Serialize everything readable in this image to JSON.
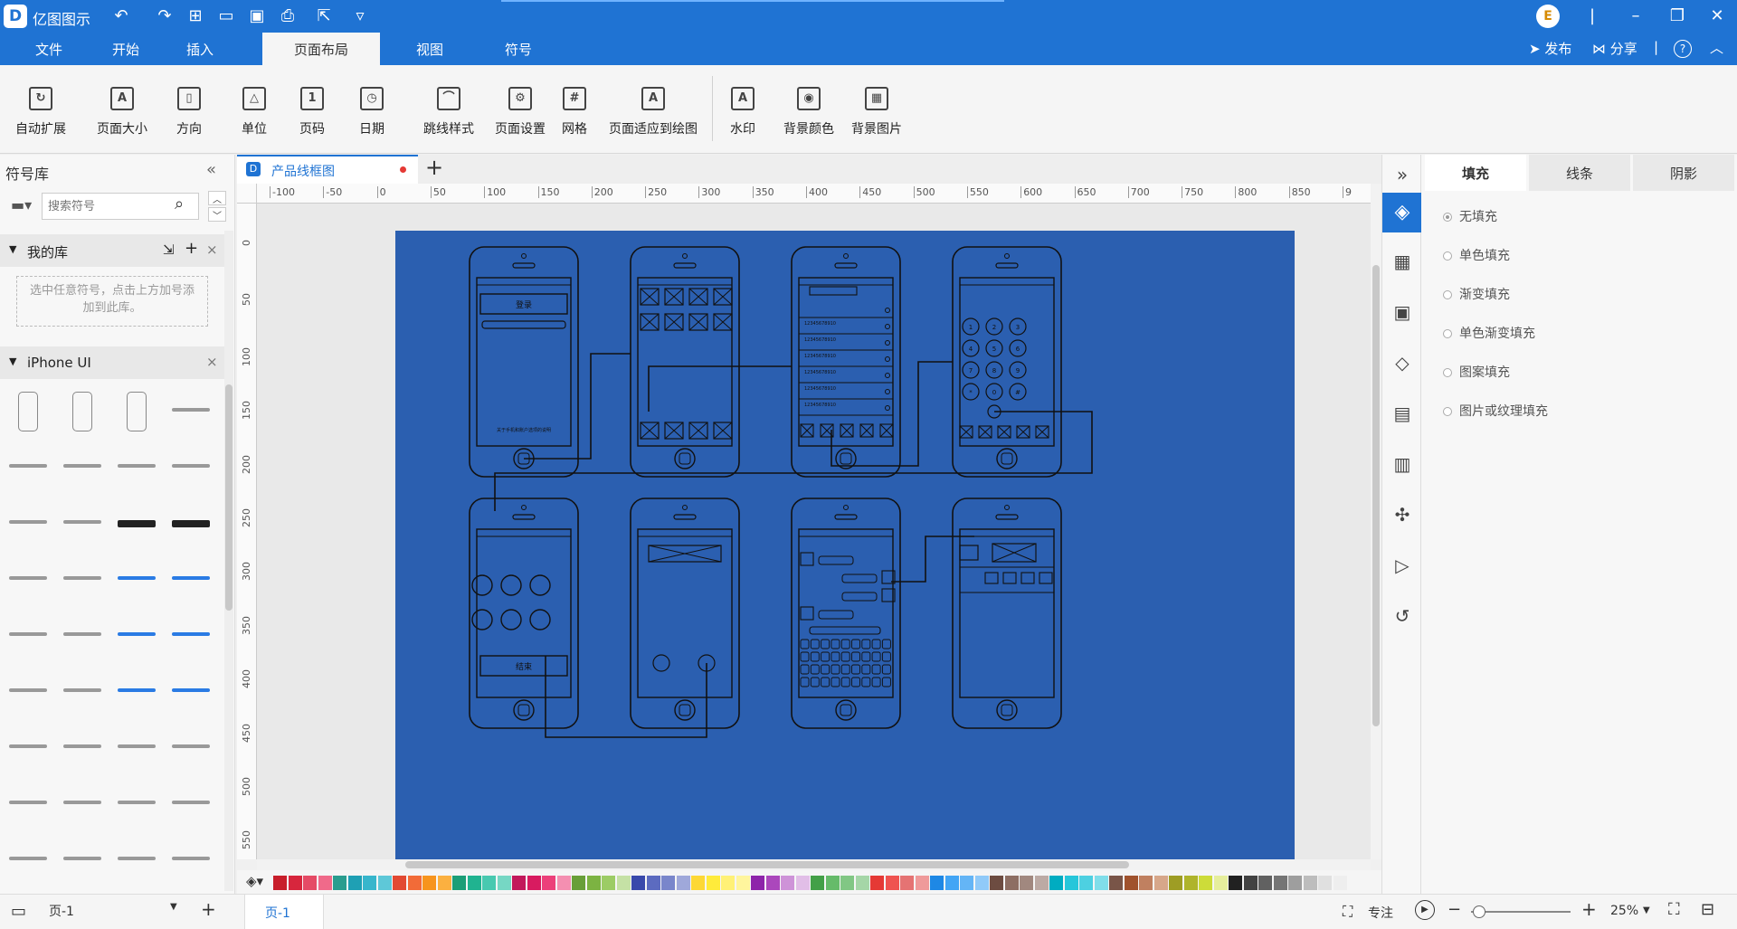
{
  "app": {
    "title": "亿图图示",
    "logo_letter": "D",
    "user_initial": "E"
  },
  "menu_tabs": [
    "文件",
    "开始",
    "插入",
    "页面布局",
    "视图",
    "符号"
  ],
  "active_tab": "页面布局",
  "title_right": {
    "publish": "发布",
    "share": "分享",
    "help": "?"
  },
  "ribbon": [
    "自动扩展",
    "页面大小",
    "方向",
    "单位",
    "页码",
    "日期",
    "跳线样式",
    "页面设置",
    "网格",
    "页面适应到绘图",
    "水印",
    "背景颜色",
    "背景图片"
  ],
  "left_panel": {
    "title": "符号库",
    "search_placeholder": "搜索符号",
    "my_library": "我的库",
    "my_library_hint": "选中任意符号，点击上方加号添加到此库。",
    "library_section": "iPhone UI"
  },
  "document": {
    "tab_name": "产品线框图",
    "page_tab": "页-1",
    "page_select": "页-1"
  },
  "ruler_top": [
    "-100",
    "-50",
    "0",
    "50",
    "100",
    "150",
    "200",
    "250",
    "300",
    "350",
    "400",
    "450",
    "500",
    "550",
    "600",
    "650",
    "700",
    "750",
    "800",
    "850",
    "9"
  ],
  "ruler_left": [
    "0",
    "50",
    "100",
    "150",
    "200",
    "250",
    "300",
    "350",
    "400",
    "450",
    "500",
    "550"
  ],
  "wireframe": {
    "login_button": "登录",
    "login_footer": "关于手机和账户选项的说明",
    "end_call_button": "结束",
    "contact_numbers": [
      "12345678910",
      "12345678910",
      "12345678910",
      "12345678910",
      "12345678910",
      "12345678910"
    ],
    "keypad": [
      "1",
      "2",
      "3",
      "4",
      "5",
      "6",
      "7",
      "8",
      "9",
      "*",
      "0",
      "#"
    ]
  },
  "right_panel": {
    "tabs": [
      "填充",
      "线条",
      "阴影"
    ],
    "active_tab": "填充",
    "fill_options": [
      "无填充",
      "单色填充",
      "渐变填充",
      "单色渐变填充",
      "图案填充",
      "图片或纹理填充"
    ],
    "selected_fill": "无填充"
  },
  "status": {
    "focus_label": "专注",
    "zoom": "25%"
  },
  "colors": {
    "brand": "#1f73d3",
    "paper": "#2b5fb0",
    "wire": "#111111"
  },
  "palette": [
    "#c81e2b",
    "#d7263d",
    "#e54b66",
    "#f06a8a",
    "#2a9d8f",
    "#1fa0b4",
    "#38b6cc",
    "#5ec8d8",
    "#e24a33",
    "#f26b38",
    "#f7941d",
    "#fbb040",
    "#1b9e77",
    "#20b390",
    "#48c9b0",
    "#76d7c4",
    "#c2185b",
    "#d81b60",
    "#ec407a",
    "#f48fb1",
    "#689f38",
    "#7cb342",
    "#9ccc65",
    "#c5e1a5",
    "#3949ab",
    "#5c6bc0",
    "#7986cb",
    "#9fa8da",
    "#fdd835",
    "#ffeb3b",
    "#fff176",
    "#fff59d",
    "#8e24aa",
    "#ab47bc",
    "#ce93d8",
    "#e1bee7",
    "#43a047",
    "#66bb6a",
    "#81c784",
    "#a5d6a7",
    "#e53935",
    "#ef5350",
    "#e57373",
    "#ef9a9a",
    "#1e88e5",
    "#42a5f5",
    "#64b5f6",
    "#90caf9",
    "#6d4c41",
    "#8d6e63",
    "#a1887f",
    "#bcaaa4",
    "#00acc1",
    "#26c6da",
    "#4dd0e1",
    "#80deea",
    "#795548",
    "#a0522d",
    "#c08060",
    "#d7a78a",
    "#9e9d24",
    "#afb42b",
    "#cddc39",
    "#e6ee9c",
    "#212121",
    "#424242",
    "#616161",
    "#757575",
    "#9e9e9e",
    "#bdbdbd",
    "#e0e0e0",
    "#eeeeee"
  ]
}
